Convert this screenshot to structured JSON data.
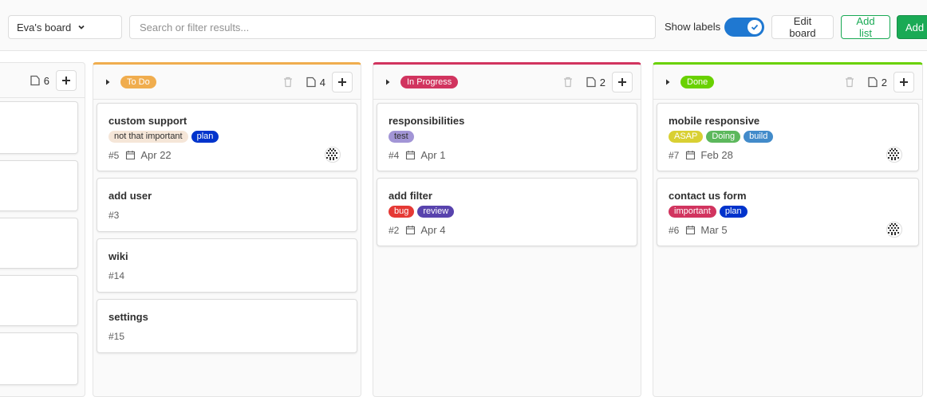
{
  "header": {
    "board_name": "Eva's board",
    "search_placeholder": "Search or filter results...",
    "show_labels": "Show labels",
    "show_labels_on": true,
    "edit_board": "Edit board",
    "add_list": "Add list",
    "add_issue": "Add i"
  },
  "colors": {
    "accent_blue": "#1f78d1",
    "green": "#1aaa55"
  },
  "partial_list": {
    "count": "6",
    "card_count": 5
  },
  "lists": [
    {
      "label": "To Do",
      "label_bg": "#f0ad4e",
      "label_fg": "#ffffff",
      "count": "4",
      "cards": [
        {
          "title": "custom support",
          "labels": [
            {
              "text": "not that important",
              "bg": "#f5e6d8",
              "fg": "#303030"
            },
            {
              "text": "plan",
              "bg": "#0033cc",
              "fg": "#ffffff"
            }
          ],
          "number": "#5",
          "due": "Apr 22",
          "avatar": true
        },
        {
          "title": "add user",
          "labels": [],
          "number": "#3",
          "due": "",
          "avatar": false
        },
        {
          "title": "wiki",
          "labels": [],
          "number": "#14",
          "due": "",
          "avatar": false
        },
        {
          "title": "settings",
          "labels": [],
          "number": "#15",
          "due": "",
          "avatar": false
        }
      ]
    },
    {
      "label": "In Progress",
      "label_bg": "#d1345f",
      "label_fg": "#ffffff",
      "count": "2",
      "cards": [
        {
          "title": "responsibilities",
          "labels": [
            {
              "text": "test",
              "bg": "#a295d6",
              "fg": "#303030"
            }
          ],
          "number": "#4",
          "due": "Apr 1",
          "avatar": false
        },
        {
          "title": "add filter",
          "labels": [
            {
              "text": "bug",
              "bg": "#e53935",
              "fg": "#ffffff"
            },
            {
              "text": "review",
              "bg": "#5843ad",
              "fg": "#ffffff"
            }
          ],
          "number": "#2",
          "due": "Apr 4",
          "avatar": false
        }
      ]
    },
    {
      "label": "Done",
      "label_bg": "#69d100",
      "label_fg": "#ffffff",
      "count": "2",
      "cards": [
        {
          "title": "mobile responsive",
          "labels": [
            {
              "text": "ASAP",
              "bg": "#d9d033",
              "fg": "#ffffff"
            },
            {
              "text": "Doing",
              "bg": "#5cb85c",
              "fg": "#ffffff"
            },
            {
              "text": "build",
              "bg": "#428bca",
              "fg": "#ffffff"
            }
          ],
          "number": "#7",
          "due": "Feb 28",
          "avatar": true
        },
        {
          "title": "contact us form",
          "labels": [
            {
              "text": "important",
              "bg": "#d1345f",
              "fg": "#ffffff"
            },
            {
              "text": "plan",
              "bg": "#0033cc",
              "fg": "#ffffff"
            }
          ],
          "number": "#6",
          "due": "Mar 5",
          "avatar": true
        }
      ]
    }
  ]
}
